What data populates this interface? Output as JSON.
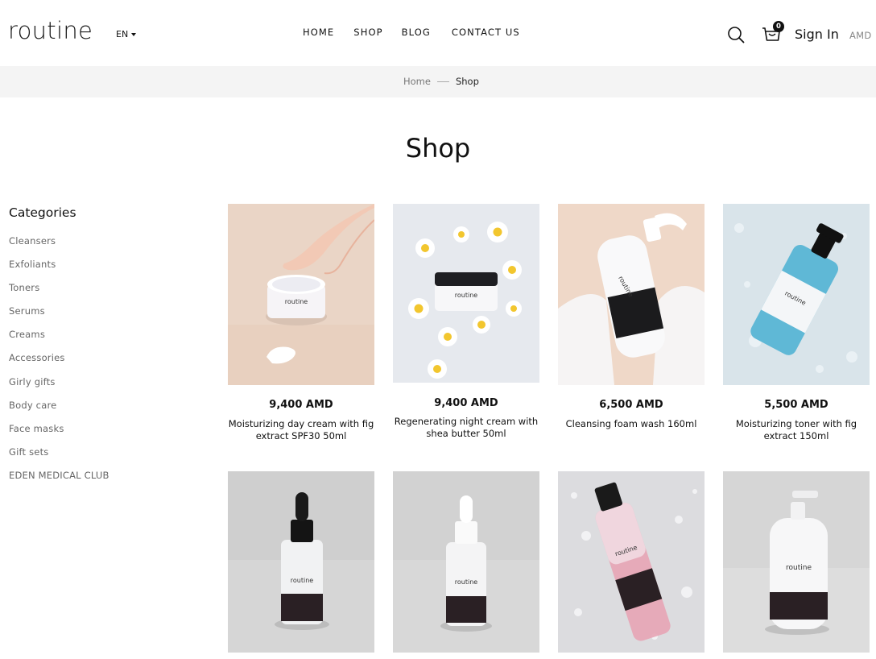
{
  "header": {
    "logo": "routine",
    "language": "EN",
    "nav": [
      "HOME",
      "SHOP",
      "BLOG",
      "CONTACT US"
    ],
    "cart_count": "0",
    "sign_in": "Sign In",
    "currency": "AMD"
  },
  "breadcrumb": {
    "home": "Home",
    "current": "Shop"
  },
  "page_title": "Shop",
  "sidebar": {
    "heading": "Categories",
    "categories": [
      "Cleansers",
      "Exfoliants",
      "Toners",
      "Serums",
      "Creams",
      "Accessories",
      "Girly gifts",
      "Body care",
      "Face masks",
      "Gift sets",
      "EDEN MEDICAL CLUB"
    ]
  },
  "products": [
    {
      "price": "9,400 AMD",
      "name": "Moisturizing day cream with fig extract SPF30 50ml"
    },
    {
      "price": "9,400 AMD",
      "name": "Regenerating night cream with shea butter 50ml"
    },
    {
      "price": "6,500 AMD",
      "name": "Cleansing foam wash 160ml"
    },
    {
      "price": "5,500 AMD",
      "name": "Moisturizing toner with fig extract 150ml"
    },
    {
      "price": "",
      "name": ""
    },
    {
      "price": "",
      "name": ""
    },
    {
      "price": "",
      "name": ""
    },
    {
      "price": "",
      "name": ""
    }
  ],
  "product_labels": {
    "brand": "routine"
  },
  "colors": {
    "breadcrumb_band": "#f4f4f4",
    "text": "#111111",
    "muted": "#666666"
  }
}
